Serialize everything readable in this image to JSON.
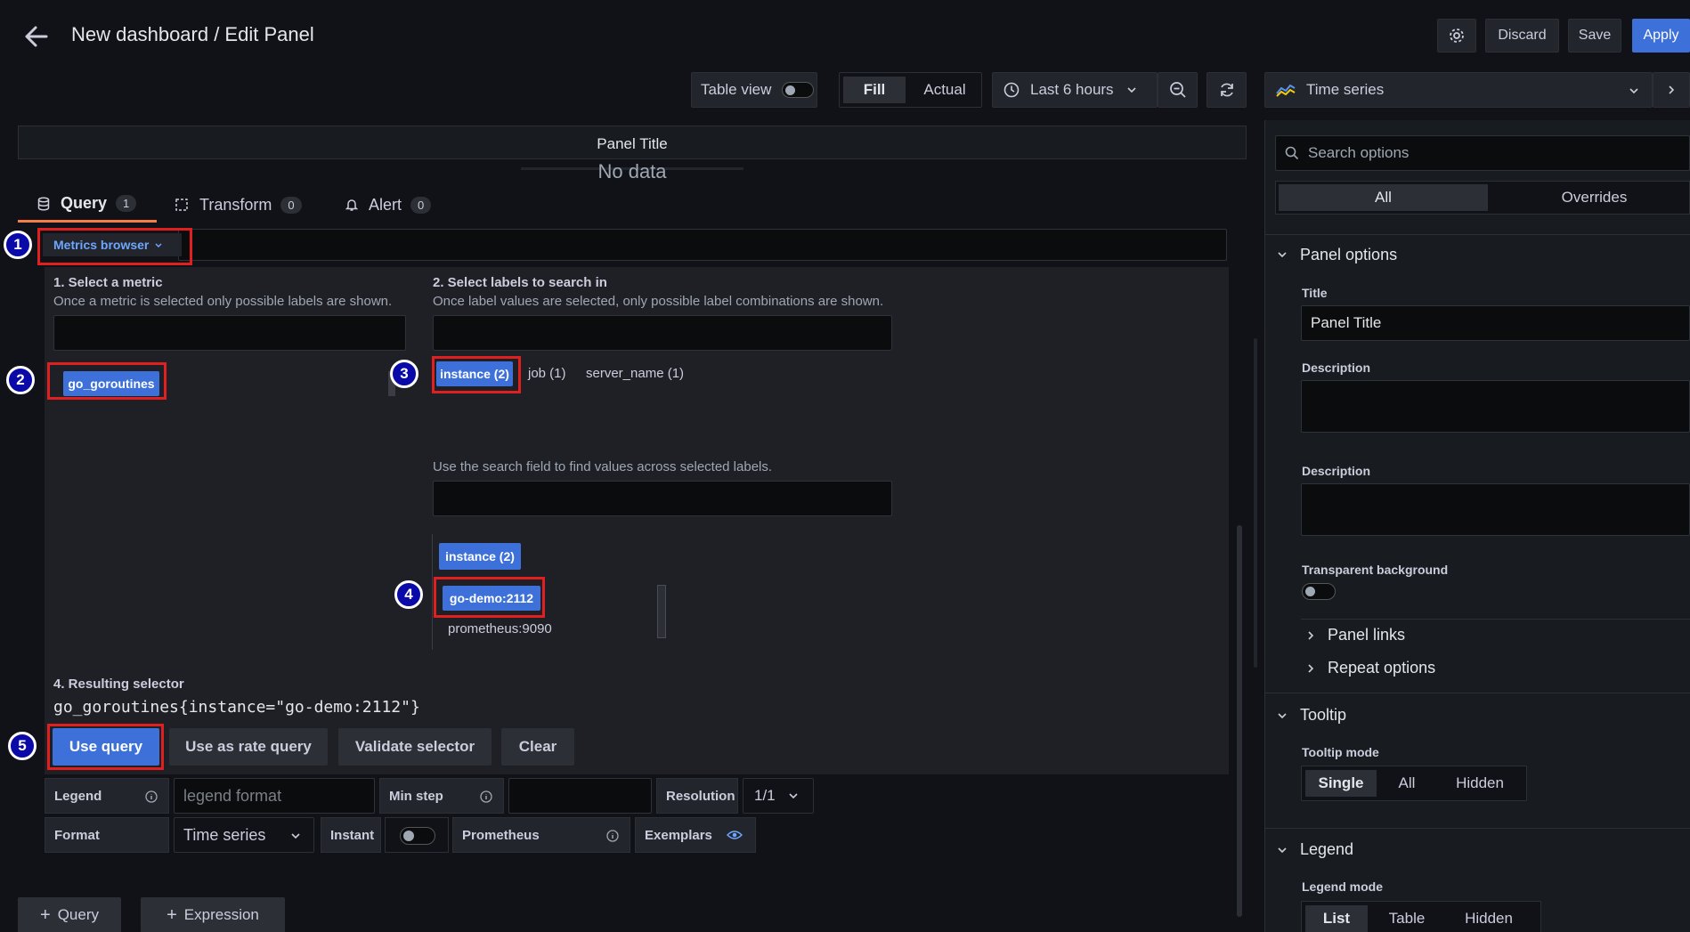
{
  "header": {
    "title": "New dashboard / Edit Panel",
    "discard_label": "Discard",
    "save_label": "Save",
    "apply_label": "Apply"
  },
  "toolbar": {
    "table_view_label": "Table view",
    "fill_label": "Fill",
    "actual_label": "Actual",
    "time_range_label": "Last 6 hours",
    "visualization_label": "Time series"
  },
  "panel": {
    "title": "Panel Title",
    "no_data": "No data"
  },
  "tabs": [
    {
      "label": "Query",
      "count": "1"
    },
    {
      "label": "Transform",
      "count": "0"
    },
    {
      "label": "Alert",
      "count": "0"
    }
  ],
  "query_editor": {
    "metrics_browser_label": "Metrics browser",
    "step1_title": "1. Select a metric",
    "step1_hint": "Once a metric is selected only possible labels are shown.",
    "step2_title": "2. Select labels to search in",
    "step2_hint": "Once label values are selected, only possible label combinations are shown.",
    "metric": "go_goroutines",
    "labels": [
      "instance (2)",
      "job (1)",
      "server_name (1)"
    ],
    "search_values_hint": "Use the search field to find values across selected labels.",
    "value_group_label": "instance (2)",
    "values": [
      "go-demo:2112",
      "prometheus:9090"
    ],
    "step4_title": "4. Resulting selector",
    "selector": "go_goroutines{instance=\"go-demo:2112\"}",
    "use_query_label": "Use query",
    "use_rate_label": "Use as rate query",
    "validate_label": "Validate selector",
    "clear_label": "Clear",
    "annotations": [
      "1",
      "2",
      "3",
      "4",
      "5"
    ]
  },
  "query_options": {
    "legend_label": "Legend",
    "legend_placeholder": "legend format",
    "min_step_label": "Min step",
    "resolution_label": "Resolution",
    "resolution_value": "1/1",
    "format_label": "Format",
    "format_value": "Time series",
    "instant_label": "Instant",
    "prometheus_label": "Prometheus",
    "exemplars_label": "Exemplars"
  },
  "bottom_buttons": {
    "query_label": "Query",
    "expression_label": "Expression"
  },
  "options_pane": {
    "search_placeholder": "Search options",
    "tab_all": "All",
    "tab_overrides": "Overrides",
    "panel_options_title": "Panel options",
    "title_label": "Title",
    "title_value": "Panel Title",
    "description_label": "Description",
    "description2_label": "Description",
    "transparent_label": "Transparent background",
    "panel_links_label": "Panel links",
    "repeat_options_label": "Repeat options",
    "tooltip_title": "Tooltip",
    "tooltip_mode_label": "Tooltip mode",
    "tooltip_modes": [
      "Single",
      "All",
      "Hidden"
    ],
    "legend_title": "Legend",
    "legend_mode_label": "Legend mode",
    "legend_modes": [
      "List",
      "Table",
      "Hidden"
    ]
  },
  "colors": {
    "background": "#111217",
    "primary": "#3d71d9",
    "annotation_red": "#e02020",
    "annotation_blue": "#0a0aa8"
  }
}
